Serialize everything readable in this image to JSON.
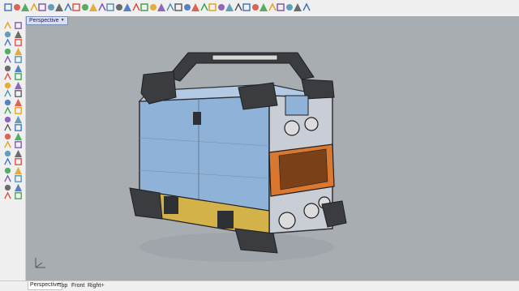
{
  "viewport": {
    "active_tab": "Perspective",
    "background": "#a8adb2"
  },
  "toolbar": {
    "icons": [
      "new-file-icon",
      "open-file-icon",
      "save-icon",
      "print-icon",
      "import-icon",
      "export-icon",
      "cut-icon",
      "copy-icon",
      "paste-icon",
      "undo-icon",
      "redo-icon",
      "select-icon",
      "pan-icon",
      "rotate-icon",
      "zoom-icon",
      "zoom-window-icon",
      "zoom-extents-icon",
      "zoom-selected-icon",
      "view-icon",
      "cplane-icon",
      "set-view-icon",
      "layer-icon",
      "properties-icon",
      "object-props-icon",
      "render-icon",
      "material-icon",
      "lights-icon",
      "sun-icon",
      "display-mode-icon",
      "options-icon",
      "help-icon",
      "grid-icon",
      "snap-icon",
      "ortho-icon",
      "osnap-icon",
      "gumball-icon"
    ]
  },
  "left_toolbar": {
    "icons": [
      "point-icon",
      "line-icon",
      "polyline-icon",
      "curve-icon",
      "arc-icon",
      "circle-icon",
      "ellipse-icon",
      "rectangle-icon",
      "polygon-icon",
      "freeform-icon",
      "offset-icon",
      "fillet-icon",
      "surface-icon",
      "loft-icon",
      "extrude-icon",
      "sweep-icon",
      "revolve-icon",
      "network-icon",
      "solid-box-icon",
      "solid-sphere-icon",
      "solid-cylinder-icon",
      "boolean-icon",
      "mesh-icon",
      "transform-icon",
      "move-icon",
      "copy-obj-icon",
      "rotate-obj-icon",
      "scale-icon",
      "mirror-icon",
      "array-icon",
      "trim-icon",
      "split-icon",
      "join-icon",
      "explode-icon",
      "group-icon",
      "dimension-icon",
      "text-icon",
      "hide-icon",
      "lock-icon",
      "analyze-icon",
      "render-obj-icon",
      "drafting-icon"
    ]
  },
  "bottom_tabs": [
    {
      "label": "Perspective",
      "active": true
    },
    {
      "label": "Top",
      "active": false
    },
    {
      "label": "Front",
      "active": false
    },
    {
      "label": "Right",
      "active": false
    }
  ],
  "bottom_add": "+",
  "colors": {
    "body_blue": "#8fb2d8",
    "frame_dark": "#2e3034",
    "accent_orange": "#d9782e",
    "base_yellow": "#d4b24a"
  }
}
